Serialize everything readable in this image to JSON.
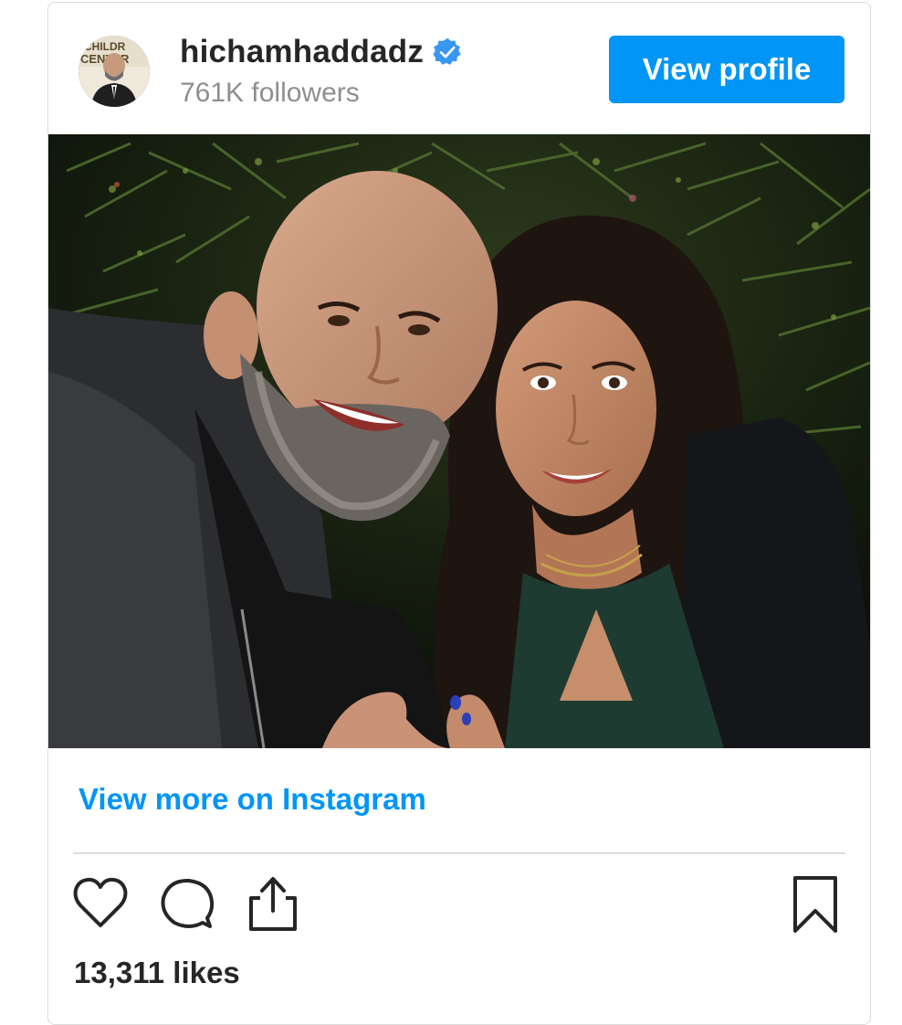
{
  "post": {
    "username": "hichamhaddadz",
    "followers": "761K followers",
    "view_profile_label": "View profile",
    "view_more_label": "View more on Instagram",
    "likes": "13,311 likes",
    "avatar_sign_text": "CHILDR CENTER",
    "verified": true
  },
  "colors": {
    "accent": "#0095f6",
    "text_primary": "#262626",
    "text_secondary": "#8e8e8e",
    "border": "#dbdbdb"
  },
  "icons": {
    "like": "heart-icon",
    "comment": "comment-icon",
    "share": "share-icon",
    "save": "bookmark-icon",
    "verified": "verified-badge-icon"
  }
}
